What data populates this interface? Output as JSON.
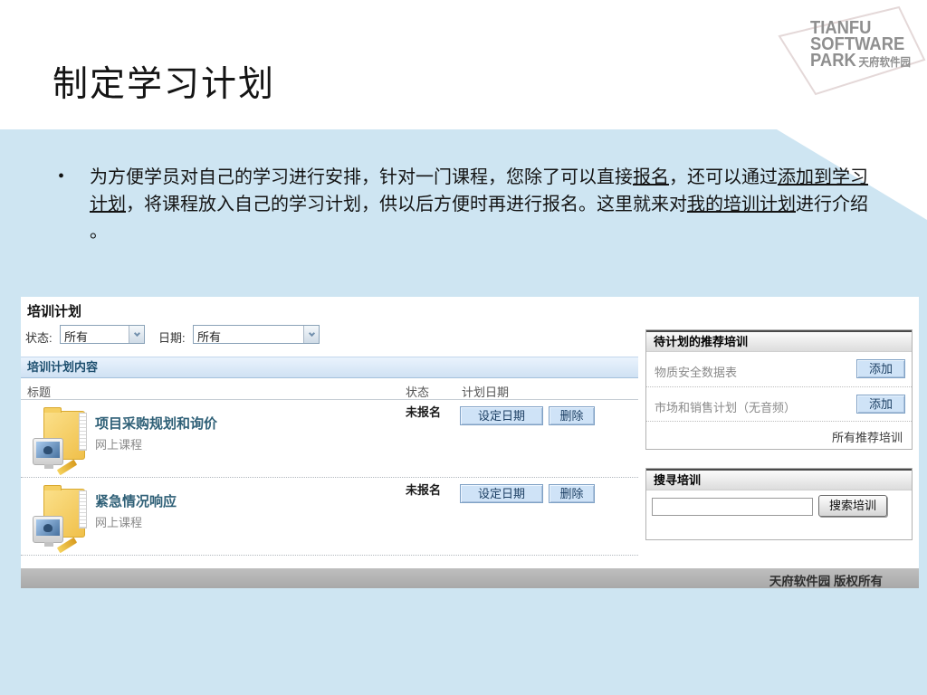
{
  "slide": {
    "title": "制定学习计划",
    "logo": {
      "line1": "TIANFU",
      "line2": "SOFTWARE",
      "line3": "PARK",
      "cn": "天府软件园"
    },
    "bullet_segments": [
      {
        "text": "为方便学员对自己的学习进行安排，针对一门课程，您除了可以直接"
      },
      {
        "text": "报名",
        "u": true
      },
      {
        "text": "，还可以通过"
      },
      {
        "text": "添加到学习",
        "u": true
      },
      {
        "br": true
      },
      {
        "text": "计划",
        "u": true
      },
      {
        "text": "，将课程放入自己的学习计划，供以后方便时再进行报名。这里就来对"
      },
      {
        "text": "我的培训计划",
        "u": true
      },
      {
        "text": "进行介绍"
      },
      {
        "br": true
      },
      {
        "text": "。"
      }
    ]
  },
  "app": {
    "page_title": "培训计划",
    "filters": {
      "status_label": "状态:",
      "status_value": "所有",
      "date_label": "日期:",
      "date_value": "所有"
    },
    "plan_section": {
      "header": "培训计划内容",
      "columns": {
        "title": "标题",
        "status": "状态",
        "plan_date": "计划日期"
      },
      "rows": [
        {
          "title": "项目采购规划和询价",
          "type": "网上课程",
          "status": "未报名",
          "set_date_label": "设定日期",
          "delete_label": "删除"
        },
        {
          "title": "紧急情况响应",
          "type": "网上课程",
          "status": "未报名",
          "set_date_label": "设定日期",
          "delete_label": "删除"
        }
      ]
    },
    "recommended": {
      "header": "待计划的推荐培训",
      "items": [
        {
          "title": "物质安全数据表",
          "add_label": "添加"
        },
        {
          "title": "市场和销售计划（无音频）",
          "add_label": "添加"
        }
      ],
      "all_link": "所有推荐培训"
    },
    "search": {
      "header": "搜寻培训",
      "input_value": "",
      "button_label": "搜索培训"
    },
    "footer": "天府软件园 版权所有"
  },
  "colors": {
    "slide_background": "#cee5f2",
    "section_header_text": "#1c4e6e",
    "course_title": "#2f6077",
    "button_blue_bg": "#cfe3f7",
    "button_blue_border": "#7fa1c5",
    "footer_bar": "#b4b4b4",
    "logo_gray": "#8f8f8f"
  }
}
